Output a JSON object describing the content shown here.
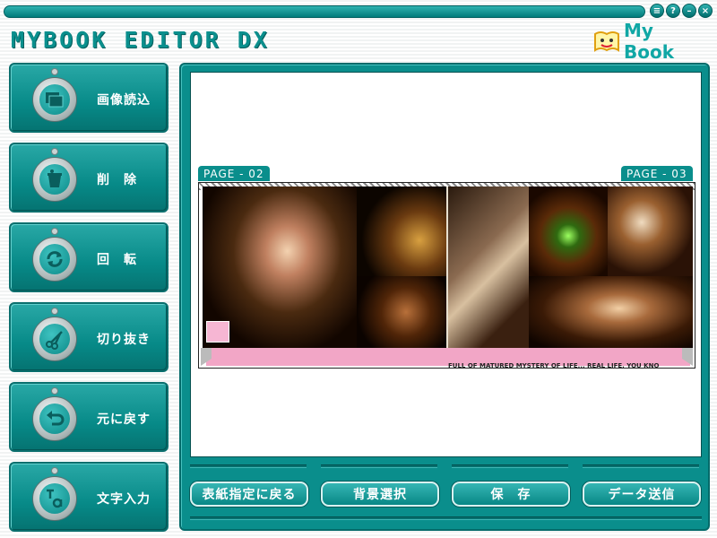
{
  "app": {
    "title": "MYBOOK EDITOR DX",
    "brand": "My Book"
  },
  "titlebar": {
    "controls": [
      "menu-icon",
      "help-icon",
      "minimize-icon",
      "close-icon"
    ]
  },
  "sidebar": {
    "items": [
      {
        "label": "画像読込",
        "icon": "image-load-icon"
      },
      {
        "label": "削　除",
        "icon": "trash-icon"
      },
      {
        "label": "回　転",
        "icon": "rotate-icon"
      },
      {
        "label": "切り抜き",
        "icon": "scissors-icon"
      },
      {
        "label": "元に戻す",
        "icon": "undo-icon"
      },
      {
        "label": "文字入力",
        "icon": "text-input-icon"
      }
    ]
  },
  "editor": {
    "left_page": "PAGE - 02",
    "right_page": "PAGE - 03",
    "caption": "FULL OF MATURED MYSTERY OF LIFE...  REAL LIFE, YOU KNO"
  },
  "actions": {
    "back_to_cover": "表紙指定に戻る",
    "background": "背景選択",
    "save": "保　存",
    "send": "データ送信"
  },
  "colors": {
    "accent": "#0a8e8c",
    "accent_dark": "#056b6a",
    "caption_bar": "#f2a6c6"
  }
}
